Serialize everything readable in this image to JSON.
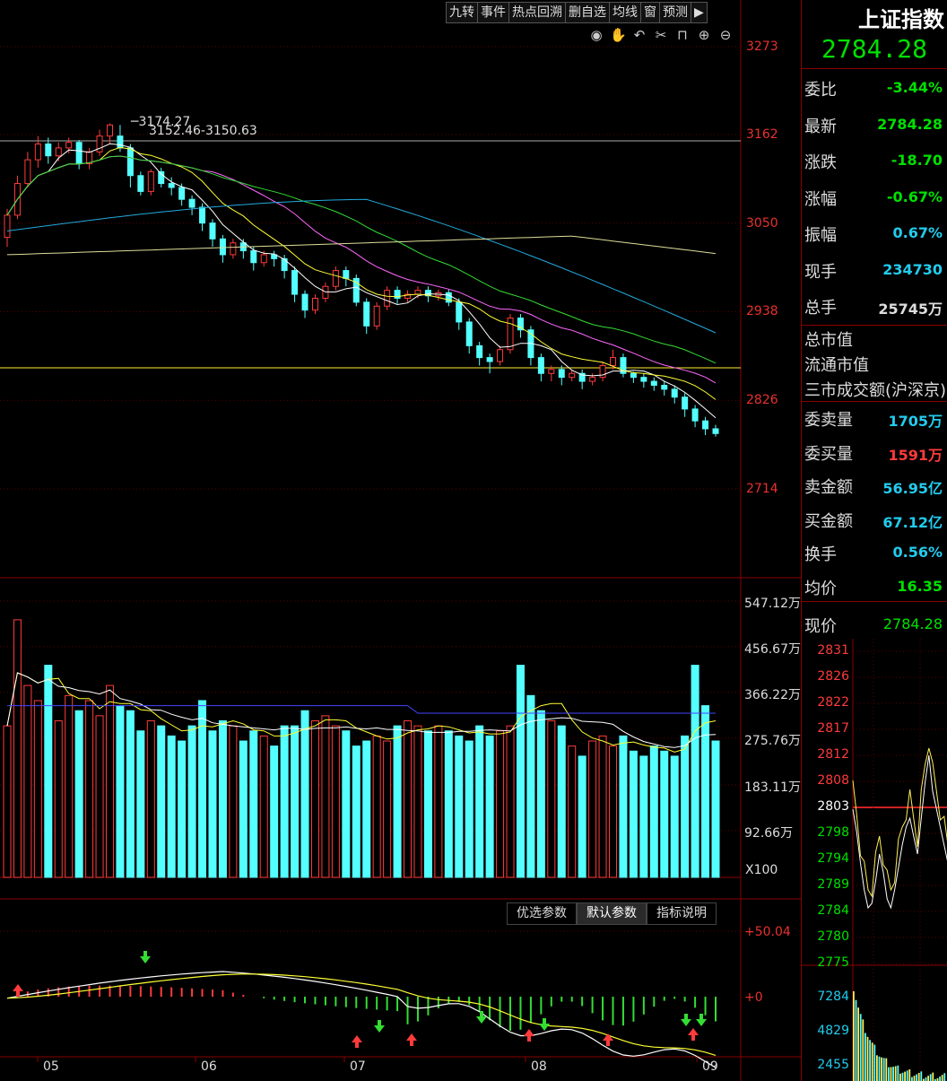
{
  "toolbar": {
    "items": [
      "九转",
      "事件",
      "热点回溯",
      "删自选",
      "均线",
      "窗",
      "预测",
      "▶"
    ]
  },
  "toolbar_icons": [
    "eye-icon",
    "hand-icon",
    "undo-icon",
    "scissors-icon",
    "lock-icon",
    "zoom-in-icon",
    "zoom-out-icon"
  ],
  "kline": {
    "high_label": "3174.27",
    "annot_label": "3152.46-3150.63",
    "y_labels": [
      "3273",
      "3162",
      "3050",
      "2938",
      "2826",
      "2714"
    ]
  },
  "volume": {
    "y_labels": [
      "547.12万",
      "456.67万",
      "366.22万",
      "275.76万",
      "183.11万",
      "92.66万"
    ],
    "unit": "X100"
  },
  "indicator": {
    "buttons": [
      "优选参数",
      "默认参数",
      "指标说明"
    ],
    "y_labels": [
      "+50.04",
      "+0"
    ]
  },
  "x_labels": [
    "05",
    "06",
    "07",
    "08",
    "09"
  ],
  "quote": {
    "name": "上证指数",
    "price": "2784.28",
    "rows": [
      {
        "k": "委比",
        "v": "-3.44%",
        "c": "#00e100"
      },
      {
        "k": "最新",
        "v": "2784.28",
        "c": "#00e100"
      },
      {
        "k": "涨跌",
        "v": "-18.70",
        "c": "#00e100"
      },
      {
        "k": "涨幅",
        "v": "-0.67%",
        "c": "#00e100"
      },
      {
        "k": "振幅",
        "v": "0.67%",
        "c": "#22ccee"
      },
      {
        "k": "现手",
        "v": "234730",
        "c": "#22ccee"
      },
      {
        "k": "总手",
        "v": "25745万",
        "c": "#ddd"
      }
    ],
    "extra": [
      "总市值",
      "流通市值",
      "三市成交额(沪深京)"
    ],
    "rows2": [
      {
        "k": "委卖量",
        "v": "1705万",
        "c": "#22ccee"
      },
      {
        "k": "委买量",
        "v": "1591万",
        "c": "#ff3b3b"
      },
      {
        "k": "卖金额",
        "v": "56.95亿",
        "c": "#22ccee"
      },
      {
        "k": "买金额",
        "v": "67.12亿",
        "c": "#22ccee"
      },
      {
        "k": "换手",
        "v": "0.56%",
        "c": "#22ccee"
      },
      {
        "k": "均价",
        "v": "16.35",
        "c": "#00e100"
      }
    ],
    "now_label": "现价",
    "now_value": "2784.28"
  },
  "minichart": {
    "price_labels": [
      "2831",
      "2826",
      "2822",
      "2817",
      "2812",
      "2808",
      "2803",
      "2798",
      "2794",
      "2789",
      "2784",
      "2780",
      "2775"
    ],
    "vol_labels": [
      "7284",
      "4829",
      "2455"
    ]
  },
  "chart_data": {
    "type": "candlestick",
    "x_ticks": [
      "05",
      "06",
      "07",
      "08",
      "09"
    ],
    "ylim": [
      2714,
      3273
    ],
    "candles": [
      [
        3032,
        3060,
        3020,
        3068
      ],
      [
        3060,
        3100,
        3055,
        3110
      ],
      [
        3100,
        3130,
        3095,
        3140
      ],
      [
        3130,
        3150,
        3120,
        3160
      ],
      [
        3150,
        3135,
        3125,
        3158
      ],
      [
        3135,
        3145,
        3128,
        3152
      ],
      [
        3145,
        3152,
        3138,
        3158
      ],
      [
        3152,
        3125,
        3118,
        3155
      ],
      [
        3125,
        3140,
        3118,
        3145
      ],
      [
        3140,
        3160,
        3135,
        3168
      ],
      [
        3160,
        3174,
        3150,
        3176
      ],
      [
        3160,
        3145,
        3140,
        3174
      ],
      [
        3145,
        3110,
        3095,
        3150
      ],
      [
        3110,
        3090,
        3085,
        3115
      ],
      [
        3090,
        3115,
        3085,
        3118
      ],
      [
        3115,
        3100,
        3095,
        3120
      ],
      [
        3100,
        3095,
        3085,
        3108
      ],
      [
        3095,
        3080,
        3072,
        3100
      ],
      [
        3080,
        3070,
        3060,
        3085
      ],
      [
        3070,
        3050,
        3040,
        3075
      ],
      [
        3050,
        3030,
        3020,
        3055
      ],
      [
        3030,
        3010,
        3000,
        3035
      ],
      [
        3010,
        3025,
        3005,
        3030
      ],
      [
        3025,
        3015,
        3005,
        3030
      ],
      [
        3015,
        3000,
        2990,
        3020
      ],
      [
        3000,
        3010,
        2995,
        3015
      ],
      [
        3010,
        3005,
        2995,
        3015
      ],
      [
        3005,
        2990,
        2980,
        3010
      ],
      [
        2990,
        2960,
        2950,
        2995
      ],
      [
        2960,
        2940,
        2930,
        2965
      ],
      [
        2940,
        2955,
        2935,
        2960
      ],
      [
        2955,
        2970,
        2950,
        2975
      ],
      [
        2970,
        2990,
        2965,
        2995
      ],
      [
        2990,
        2980,
        2970,
        2995
      ],
      [
        2980,
        2950,
        2945,
        2985
      ],
      [
        2950,
        2920,
        2910,
        2955
      ],
      [
        2920,
        2945,
        2915,
        2950
      ],
      [
        2945,
        2965,
        2940,
        2970
      ],
      [
        2965,
        2955,
        2948,
        2970
      ],
      [
        2955,
        2960,
        2950,
        2965
      ],
      [
        2960,
        2965,
        2955,
        2970
      ],
      [
        2965,
        2958,
        2950,
        2970
      ],
      [
        2958,
        2962,
        2952,
        2966
      ],
      [
        2962,
        2950,
        2945,
        2966
      ],
      [
        2950,
        2925,
        2915,
        2955
      ],
      [
        2925,
        2895,
        2885,
        2930
      ],
      [
        2895,
        2880,
        2870,
        2900
      ],
      [
        2880,
        2875,
        2860,
        2885
      ],
      [
        2875,
        2890,
        2870,
        2895
      ],
      [
        2890,
        2930,
        2885,
        2935
      ],
      [
        2930,
        2915,
        2905,
        2935
      ],
      [
        2915,
        2880,
        2870,
        2920
      ],
      [
        2880,
        2860,
        2850,
        2885
      ],
      [
        2860,
        2865,
        2850,
        2870
      ],
      [
        2865,
        2855,
        2845,
        2870
      ],
      [
        2855,
        2860,
        2850,
        2865
      ],
      [
        2860,
        2850,
        2840,
        2865
      ],
      [
        2850,
        2855,
        2845,
        2860
      ],
      [
        2855,
        2870,
        2850,
        2875
      ],
      [
        2870,
        2880,
        2865,
        2890
      ],
      [
        2880,
        2860,
        2855,
        2885
      ],
      [
        2860,
        2855,
        2848,
        2862
      ],
      [
        2855,
        2850,
        2842,
        2860
      ],
      [
        2850,
        2845,
        2838,
        2855
      ],
      [
        2845,
        2840,
        2832,
        2850
      ],
      [
        2840,
        2830,
        2822,
        2845
      ],
      [
        2830,
        2815,
        2805,
        2835
      ],
      [
        2815,
        2800,
        2792,
        2820
      ],
      [
        2800,
        2790,
        2782,
        2805
      ],
      [
        2790,
        2784,
        2780,
        2795
      ]
    ],
    "volume": [
      300,
      510,
      380,
      350,
      420,
      310,
      360,
      330,
      350,
      320,
      380,
      340,
      330,
      290,
      310,
      300,
      280,
      270,
      300,
      350,
      290,
      310,
      300,
      270,
      290,
      280,
      260,
      300,
      300,
      330,
      310,
      320,
      300,
      290,
      260,
      270,
      280,
      270,
      300,
      310,
      300,
      290,
      300,
      290,
      280,
      270,
      300,
      280,
      290,
      300,
      420,
      360,
      330,
      310,
      300,
      260,
      240,
      270,
      280,
      260,
      280,
      250,
      240,
      260,
      250,
      240,
      280,
      420,
      340,
      270
    ],
    "volume_ylim": [
      0,
      547.12
    ],
    "macd_ylim": [
      -30,
      50.04
    ]
  }
}
